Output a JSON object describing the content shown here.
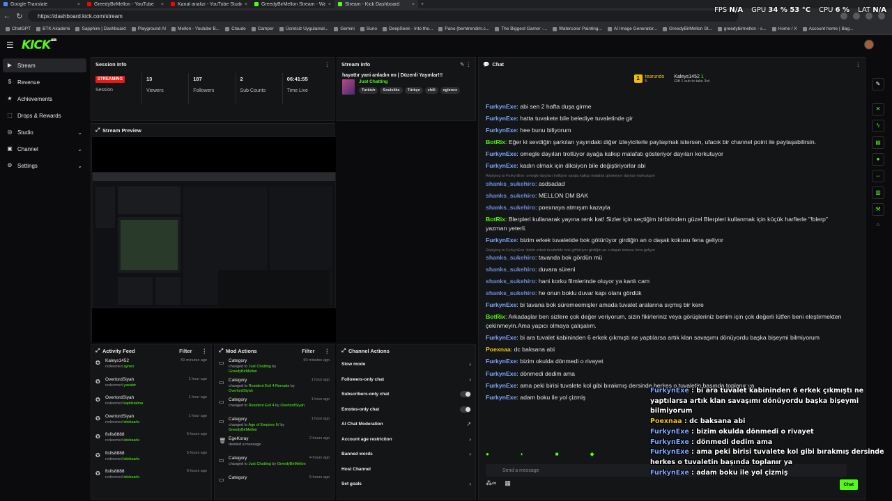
{
  "browser": {
    "tabs": [
      {
        "title": "Google Translate",
        "color": "#4a89f3",
        "active": false
      },
      {
        "title": "GreedyBirMellon - YouTube",
        "color": "#ff0000",
        "active": false
      },
      {
        "title": "Kanal analizi - YouTube Studio",
        "color": "#ff0000",
        "active": false
      },
      {
        "title": "GreedyBirMellon Stream - Watch",
        "color": "#53fc18",
        "active": false
      },
      {
        "title": "Stream - Kick Dashboard",
        "color": "#53fc18",
        "active": true
      }
    ],
    "new_tab": "+",
    "url": "https://dashboard.kick.com/stream",
    "bookmarks": [
      "ChatGPT",
      "BTK Akademi",
      "Sapphire | Dashboard",
      "Playground AI",
      "Mellon - Youtube B...",
      "Claude",
      "Camper",
      "Ücretsiz Uygulamal...",
      "Gemini",
      "Suno",
      "DeepSeek - Into the...",
      "Pano (bemtrendim.c...",
      "The Biggest Gamer -...",
      "Watercolor Painting...",
      "AI Image Generator...",
      "GreedyBirMellon St...",
      "greedybirmellon - s...",
      "Home / X",
      "Account home | Bag..."
    ]
  },
  "osd": {
    "fps_label": "FPS",
    "fps_value": "N/A",
    "gpu_label": "GPU",
    "gpu_value": "34 % 53 °C",
    "cpu_label": "CPU",
    "cpu_value": "6 %",
    "lat_label": "LAT",
    "lat_value": "N/A"
  },
  "header": {
    "logo": "KICK",
    "beta": "BETA"
  },
  "sidebar": {
    "items": [
      {
        "label": "Stream",
        "icon": "▶",
        "active": true,
        "expand": false
      },
      {
        "label": "Revenue",
        "icon": "$",
        "active": false,
        "expand": false
      },
      {
        "label": "Achievements",
        "icon": "★",
        "active": false,
        "expand": false
      },
      {
        "label": "Drops & Rewards",
        "icon": "⬚",
        "active": false,
        "expand": false
      },
      {
        "label": "Studio",
        "icon": "◎",
        "active": false,
        "expand": true
      },
      {
        "label": "Channel",
        "icon": "▣",
        "active": false,
        "expand": true
      },
      {
        "label": "Settings",
        "icon": "⚙",
        "active": false,
        "expand": true
      }
    ]
  },
  "session": {
    "title": "Session Info",
    "badge": "STREAMING",
    "session_label": "Session",
    "viewers_value": "13",
    "viewers_label": "Viewers",
    "followers_value": "187",
    "followers_label": "Followers",
    "subs_value": "2",
    "subs_label": "Sub Counts",
    "time_value": "06:41:55",
    "time_label": "Time Live"
  },
  "stream_info": {
    "title": "Stream info",
    "stream_title": "hayattır yani anladın mı | Düzenli Yayınlar!!!",
    "category": "Just Chatting",
    "tags": [
      "Turkish",
      "Soulslike",
      "Türkçe",
      "chill",
      "eglence"
    ]
  },
  "preview": {
    "title": "Stream Preview"
  },
  "chat": {
    "title": "Chat",
    "gift_left_user": "tearundo",
    "gift_left_count": "5",
    "gift_right_user": "Kaleys1452",
    "gift_right_count": "1",
    "gift_note": "Gift 1 sub to take 3rd",
    "input_placeholder": "Send a message",
    "send_label": "Chat",
    "messages": [
      {
        "user": "FurkynExe",
        "text": "abi sen 2 hafta duşa girme",
        "color": "#7ea7ff",
        "reply": ""
      },
      {
        "user": "FurkynExe",
        "text": "hatta tuvakete bile belediye tuvaletinde gir",
        "color": "#7ea7ff",
        "reply": ""
      },
      {
        "user": "FurkynExe",
        "text": "hee bunu biliyorum",
        "color": "#7ea7ff",
        "reply": ""
      },
      {
        "user": "BotRix",
        "text": "Eğer ki sevdiğin şarkıları yayındaki diğer izleyicilerle paylaşmak istersen, ufacık bir channel point ile paylaşabilirsin.",
        "color": "#53fc18",
        "reply": ""
      },
      {
        "user": "FurkynExe",
        "text": "omegle dayıları trollüyor ayağa kalkıp malafatı gösteriyor dayıları korkutuyor",
        "color": "#7ea7ff",
        "reply": ""
      },
      {
        "user": "FurkynExe",
        "text": "kadın olmak için diksiyon bile değiştiriyorlar abi",
        "color": "#7ea7ff",
        "reply": ""
      },
      {
        "user": "shanks_sukehiro",
        "text": "asdsadad",
        "color": "#6f8fd8",
        "reply": "Replying to FurkynExe: omegle dayıları trollüyor ayağa kalkıp malafatı gösteriyor dayıları korkutuyor"
      },
      {
        "user": "shanks_sukehiro",
        "text": "MELLON DM BAK",
        "color": "#6f8fd8",
        "reply": ""
      },
      {
        "user": "shanks_sukehiro",
        "text": "poexnaya atmışım kazayla",
        "color": "#6f8fd8",
        "reply": ""
      },
      {
        "user": "BotRix",
        "text": "Blerpleri kullanarak yayına renk kat! Sizler için seçtiğim birbirinden güzel Blerpleri kullanmak için küçük harflerle \"!blerp\" yazman yeterli.",
        "color": "#53fc18",
        "reply": ""
      },
      {
        "user": "FurkynExe",
        "text": "bizim erkek tuvaletide bok götürüyor girdiğin an o daşak kokusu fena geliyor",
        "color": "#7ea7ff",
        "reply": ""
      },
      {
        "user": "shanks_sukehiro",
        "text": "tavanda bok gördün mü",
        "color": "#6f8fd8",
        "reply": "Replying to FurkynExe: bizim erkek tuvaletide bok götürüyor girdiğin an o daşak kokusu fena geliyor"
      },
      {
        "user": "shanks_sukehiro",
        "text": "duvara süreni",
        "color": "#6f8fd8",
        "reply": ""
      },
      {
        "user": "shanks_sukehiro",
        "text": "hani korku filmlerinde oluyor ya kanlı cam",
        "color": "#6f8fd8",
        "reply": ""
      },
      {
        "user": "shanks_sukehiro",
        "text": "he onun boklu duvar kapı olanı gördük",
        "color": "#6f8fd8",
        "reply": ""
      },
      {
        "user": "FurkynExe",
        "text": "bi tavana bok süremeemişler amada tuvalet aralarına sıçmış bir kere",
        "color": "#7ea7ff",
        "reply": ""
      },
      {
        "user": "BotRix",
        "text": "Arkadaşlar ben sizlere çok değer veriyorum, sizin fikirleriniz veya görüşleriniz benim için çok değerli lütfen beni eleştirmekten çekinmeyin.Ama yapıcı olmaya çalışalım.",
        "color": "#53fc18",
        "reply": ""
      },
      {
        "user": "FurkynExe",
        "text": "bi ara tuvalet kabininden 6 erkek çıkmıştı ne yaptılarsa artık klan savaşımı dönüyordu başka bişeymi bilmiyorum",
        "color": "#7ea7ff",
        "reply": ""
      },
      {
        "user": "Poexnaa",
        "text": "dc baksana abi",
        "color": "#f0c419",
        "reply": ""
      },
      {
        "user": "FurkynExe",
        "text": "bizim okulda dönmedi o rivayet",
        "color": "#7ea7ff",
        "reply": ""
      },
      {
        "user": "FurkynExe",
        "text": "dönmedi dedim ama",
        "color": "#7ea7ff",
        "reply": ""
      },
      {
        "user": "FurkynExe",
        "text": "ama peki birisi tuvalete kol gibi bırakmış dersinde herkes o tuvaletin başında toplanır ya",
        "color": "#7ea7ff",
        "reply": ""
      },
      {
        "user": "FurkynExe",
        "text": "adam boku ile yol çizmiş",
        "color": "#7ea7ff",
        "reply": ""
      }
    ]
  },
  "overlay": [
    {
      "user": "FurkynExe",
      "text": "bi ara tuvalet kabininden 6 erkek çıkmıştı ne yaptılarsa artık klan savaşımı dönüyordu başka bişeymi bilmiyorum",
      "gold": false
    },
    {
      "user": "Poexnaa",
      "text": "dc baksana abi",
      "gold": true
    },
    {
      "user": "FurkynExe",
      "text": "bizim okulda dönmedi o rivayet",
      "gold": false
    },
    {
      "user": "FurkynExe",
      "text": "dönmedi dedim ama",
      "gold": false
    },
    {
      "user": "FurkynExe",
      "text": "ama peki birisi tuvalete kol gibi bırakmış dersinde herkes o tuvaletin başında toplanır ya",
      "gold": false
    },
    {
      "user": "FurkynExe",
      "text": "adam boku ile yol çizmiş",
      "gold": false
    }
  ],
  "activity": {
    "title": "Activity Feed",
    "filter": "Filter",
    "items": [
      {
        "user": "Kaleys1452",
        "action": "redeemed",
        "target": "aynen",
        "time": "50 minutes ago"
      },
      {
        "user": "OverlordSiyah",
        "action": "redeemed",
        "target": "yasabir",
        "time": "1 hour ago"
      },
      {
        "user": "OverlordSiyah",
        "action": "redeemed",
        "target": "kapitkiatma",
        "time": "1 hour ago"
      },
      {
        "user": "OverlordSiyah",
        "action": "redeemed",
        "target": "isteksarkı",
        "time": "1 hour ago"
      },
      {
        "user": "fisfis8888",
        "action": "redeemed",
        "target": "isteksarkı",
        "time": "5 hours ago"
      },
      {
        "user": "fisfis8888",
        "action": "redeemed",
        "target": "isteksarkı",
        "time": "5 hours ago"
      },
      {
        "user": "fisfis8888",
        "action": "redeemed",
        "target": "isteksarkı",
        "time": "6 hours ago"
      }
    ]
  },
  "mod": {
    "title": "Mod Actions",
    "filter": "Filter",
    "items": [
      {
        "title": "Category",
        "pre": "changed to",
        "cat": "Just Chatting",
        "by": "by",
        "user": "GreedyBirMellon",
        "time": "50 minutes ago"
      },
      {
        "title": "Category",
        "pre": "changed to",
        "cat": "Resident Evil 4 Remake",
        "by": "by",
        "user": "OverlordSiyah",
        "time": "1 hour ago"
      },
      {
        "title": "Category",
        "pre": "changed to",
        "cat": "Resident Evil 4",
        "by": "by",
        "user": "OverlordSiyah",
        "time": "1 hour ago"
      },
      {
        "title": "Category",
        "pre": "changed to",
        "cat": "Age of Empires IV",
        "by": "by",
        "user": "GreedyBirMellon",
        "time": "1 hour ago"
      },
      {
        "title": "EgeKoray",
        "pre": "deleted a message",
        "cat": "",
        "by": "",
        "user": "",
        "time": "2 hours ago"
      },
      {
        "title": "Category",
        "pre": "changed to",
        "cat": "Just Chatting",
        "by": "by",
        "user": "GreedyBirMellon",
        "time": "4 hours ago"
      },
      {
        "title": "Category",
        "pre": "",
        "cat": "",
        "by": "",
        "user": "",
        "time": "5 hours ago"
      }
    ]
  },
  "channel_actions": {
    "title": "Channel Actions",
    "items": [
      {
        "label": "Slow mode",
        "kind": "chevron"
      },
      {
        "label": "Followers-only chat",
        "kind": "chevron"
      },
      {
        "label": "Subscribers-only chat",
        "kind": "toggle"
      },
      {
        "label": "Emotes-only chat",
        "kind": "toggle"
      },
      {
        "label": "AI Chat Moderation",
        "kind": "external"
      },
      {
        "label": "Account age restriction",
        "kind": "chevron"
      },
      {
        "label": "Banned words",
        "kind": "chevron"
      },
      {
        "label": "Host Channel",
        "kind": "none"
      },
      {
        "label": "Set goals",
        "kind": "chevron"
      }
    ]
  },
  "colors": {
    "accent": "#53fc18",
    "live": "#e91916",
    "panel": "#141517",
    "bg": "#0b0b0d"
  }
}
